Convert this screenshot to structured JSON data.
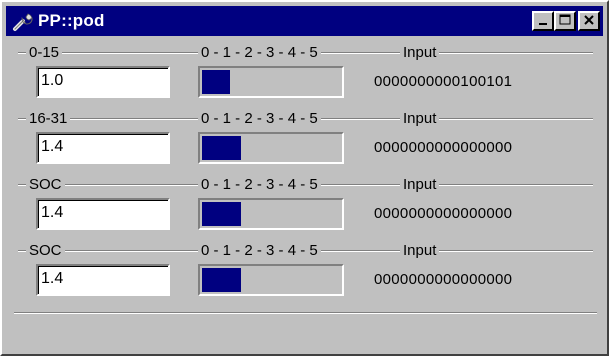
{
  "window": {
    "title": "PP::pod",
    "title_icon": "wrench-icon",
    "controls": [
      "minimize-icon",
      "maximize-icon",
      "close-icon"
    ]
  },
  "colors": {
    "title_bar": "#000080",
    "face": "#c0c0c0",
    "bar_fill": "#000080"
  },
  "rows": [
    {
      "name": "0-15",
      "scale": "0 - 1 - 2 - 3 - 4 - 5",
      "input_label": "Input",
      "value": "1.0",
      "level": 0.2,
      "bits": "0000000000100101"
    },
    {
      "name": "16-31",
      "scale": "0 - 1 - 2 - 3 - 4 - 5",
      "input_label": "Input",
      "value": "1.4",
      "level": 0.28,
      "bits": "0000000000000000"
    },
    {
      "name": "SOC",
      "scale": "0 - 1 - 2 - 3 - 4 - 5",
      "input_label": "Input",
      "value": "1.4",
      "level": 0.28,
      "bits": "0000000000000000"
    },
    {
      "name": "SOC",
      "scale": "0 - 1 - 2 - 3 - 4 - 5",
      "input_label": "Input",
      "value": "1.4",
      "level": 0.28,
      "bits": "0000000000000000"
    }
  ]
}
